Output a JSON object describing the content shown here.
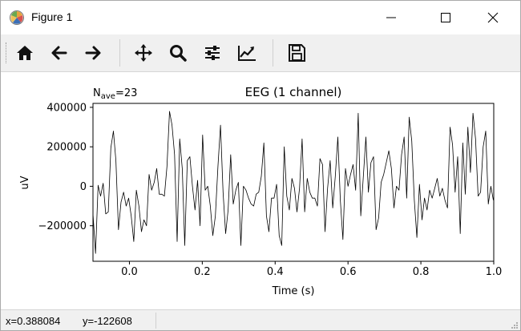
{
  "window": {
    "title": "Figure 1",
    "controls": {
      "minimize": "minimize",
      "maximize": "maximize",
      "close": "close"
    }
  },
  "toolbar": {
    "items": [
      {
        "name": "home",
        "icon": "home-icon"
      },
      {
        "name": "back",
        "icon": "arrow-left-icon"
      },
      {
        "name": "forward",
        "icon": "arrow-right-icon"
      },
      {
        "name": "pan",
        "icon": "move-icon"
      },
      {
        "name": "zoom",
        "icon": "magnifier-icon"
      },
      {
        "name": "subplots",
        "icon": "sliders-icon"
      },
      {
        "name": "axes",
        "icon": "line-chart-icon"
      },
      {
        "name": "save",
        "icon": "floppy-disk-icon"
      }
    ]
  },
  "chart_data": {
    "type": "line",
    "title": "EEG (1 channel)",
    "nave_label": "N",
    "nave_subscript": "ave",
    "nave_value": "=23",
    "xlabel": "Time (s)",
    "ylabel": "uV",
    "xlim": [
      -0.1,
      1.0
    ],
    "ylim": [
      -380000,
      420000
    ],
    "xticks": [
      0.0,
      0.2,
      0.4,
      0.6,
      0.8,
      1.0
    ],
    "xtick_labels": [
      "0.0",
      "0.2",
      "0.4",
      "0.6",
      "0.8",
      "1.0"
    ],
    "yticks": [
      400000,
      200000,
      0,
      -200000
    ],
    "ytick_labels": [
      "400000",
      "200000",
      "0",
      "−200000"
    ],
    "line_color": "#000000",
    "series": [
      {
        "x": [
          -0.1,
          -0.093,
          -0.086,
          -0.079,
          -0.072,
          -0.065,
          -0.058,
          -0.051,
          -0.044,
          -0.037,
          -0.03,
          -0.023,
          -0.016,
          -0.009,
          -0.002,
          0.005,
          0.012,
          0.019,
          0.026,
          0.033,
          0.04,
          0.047,
          0.054,
          0.061,
          0.068,
          0.075,
          0.082,
          0.089,
          0.096,
          0.103,
          0.11,
          0.117,
          0.124,
          0.131,
          0.138,
          0.145,
          0.152,
          0.159,
          0.166,
          0.173,
          0.18,
          0.187,
          0.194,
          0.201,
          0.208,
          0.215,
          0.222,
          0.229,
          0.236,
          0.243,
          0.25,
          0.257,
          0.264,
          0.271,
          0.278,
          0.285,
          0.292,
          0.299,
          0.306,
          0.313,
          0.32,
          0.327,
          0.334,
          0.341,
          0.348,
          0.355,
          0.362,
          0.369,
          0.376,
          0.383,
          0.39,
          0.397,
          0.404,
          0.411,
          0.418,
          0.425,
          0.432,
          0.439,
          0.446,
          0.453,
          0.46,
          0.467,
          0.474,
          0.481,
          0.488,
          0.495,
          0.502,
          0.509,
          0.516,
          0.523,
          0.53,
          0.537,
          0.544,
          0.551,
          0.558,
          0.565,
          0.572,
          0.579,
          0.586,
          0.593,
          0.6,
          0.607,
          0.614,
          0.621,
          0.628,
          0.635,
          0.642,
          0.649,
          0.656,
          0.663,
          0.67,
          0.677,
          0.684,
          0.691,
          0.698,
          0.705,
          0.712,
          0.719,
          0.726,
          0.733,
          0.74,
          0.747,
          0.754,
          0.761,
          0.768,
          0.775,
          0.782,
          0.789,
          0.796,
          0.803,
          0.81,
          0.817,
          0.824,
          0.831,
          0.838,
          0.845,
          0.852,
          0.859,
          0.866,
          0.873,
          0.88,
          0.887,
          0.894,
          0.901,
          0.908,
          0.915,
          0.922,
          0.929,
          0.936,
          0.943,
          0.95,
          0.957,
          0.964,
          0.971,
          0.978,
          0.985,
          0.992,
          0.999
        ],
        "y": [
          -140000,
          -340000,
          5000,
          -50000,
          15000,
          -140000,
          -130000,
          195000,
          280000,
          130000,
          -220000,
          -80000,
          -30000,
          -100000,
          -60000,
          -150000,
          -280000,
          -20000,
          -100000,
          -230000,
          -170000,
          -200000,
          60000,
          -20000,
          20000,
          90000,
          -40000,
          -40000,
          -50000,
          100000,
          380000,
          310000,
          160000,
          -280000,
          240000,
          90000,
          -300000,
          130000,
          150000,
          0,
          -120000,
          30000,
          -200000,
          260000,
          -20000,
          0,
          -100000,
          -250000,
          -150000,
          100000,
          310000,
          -30000,
          -240000,
          -120000,
          160000,
          -90000,
          -20000,
          20000,
          -300000,
          0,
          -20000,
          -60000,
          -90000,
          -100000,
          -40000,
          -30000,
          50000,
          220000,
          -150000,
          -230000,
          -60000,
          -60000,
          10000,
          -250000,
          -300000,
          200000,
          -50000,
          -120000,
          40000,
          -10000,
          -130000,
          -10000,
          240000,
          -130000,
          40000,
          -30000,
          -60000,
          -60000,
          -100000,
          140000,
          110000,
          -230000,
          -10000,
          130000,
          -110000,
          50000,
          250000,
          -70000,
          -270000,
          90000,
          0,
          60000,
          110000,
          -20000,
          370000,
          -150000,
          50000,
          250000,
          -30000,
          120000,
          150000,
          -220000,
          -160000,
          20000,
          60000,
          120000,
          180000,
          90000,
          -110000,
          0,
          -20000,
          160000,
          250000,
          -60000,
          350000,
          230000,
          -70000,
          -260000,
          10000,
          -170000,
          -60000,
          -120000,
          -20000,
          -60000,
          -10000,
          40000,
          -50000,
          -10000,
          -70000,
          -110000,
          300000,
          210000,
          -30000,
          150000,
          -240000,
          220000,
          -40000,
          300000,
          70000,
          370000,
          240000,
          -50000,
          -30000,
          200000,
          280000,
          -90000,
          0,
          -70000
        ],
        "stroke_color": "#000000"
      }
    ]
  },
  "status": {
    "x_label": "x=0.388084",
    "y_label": "y=-122608"
  }
}
